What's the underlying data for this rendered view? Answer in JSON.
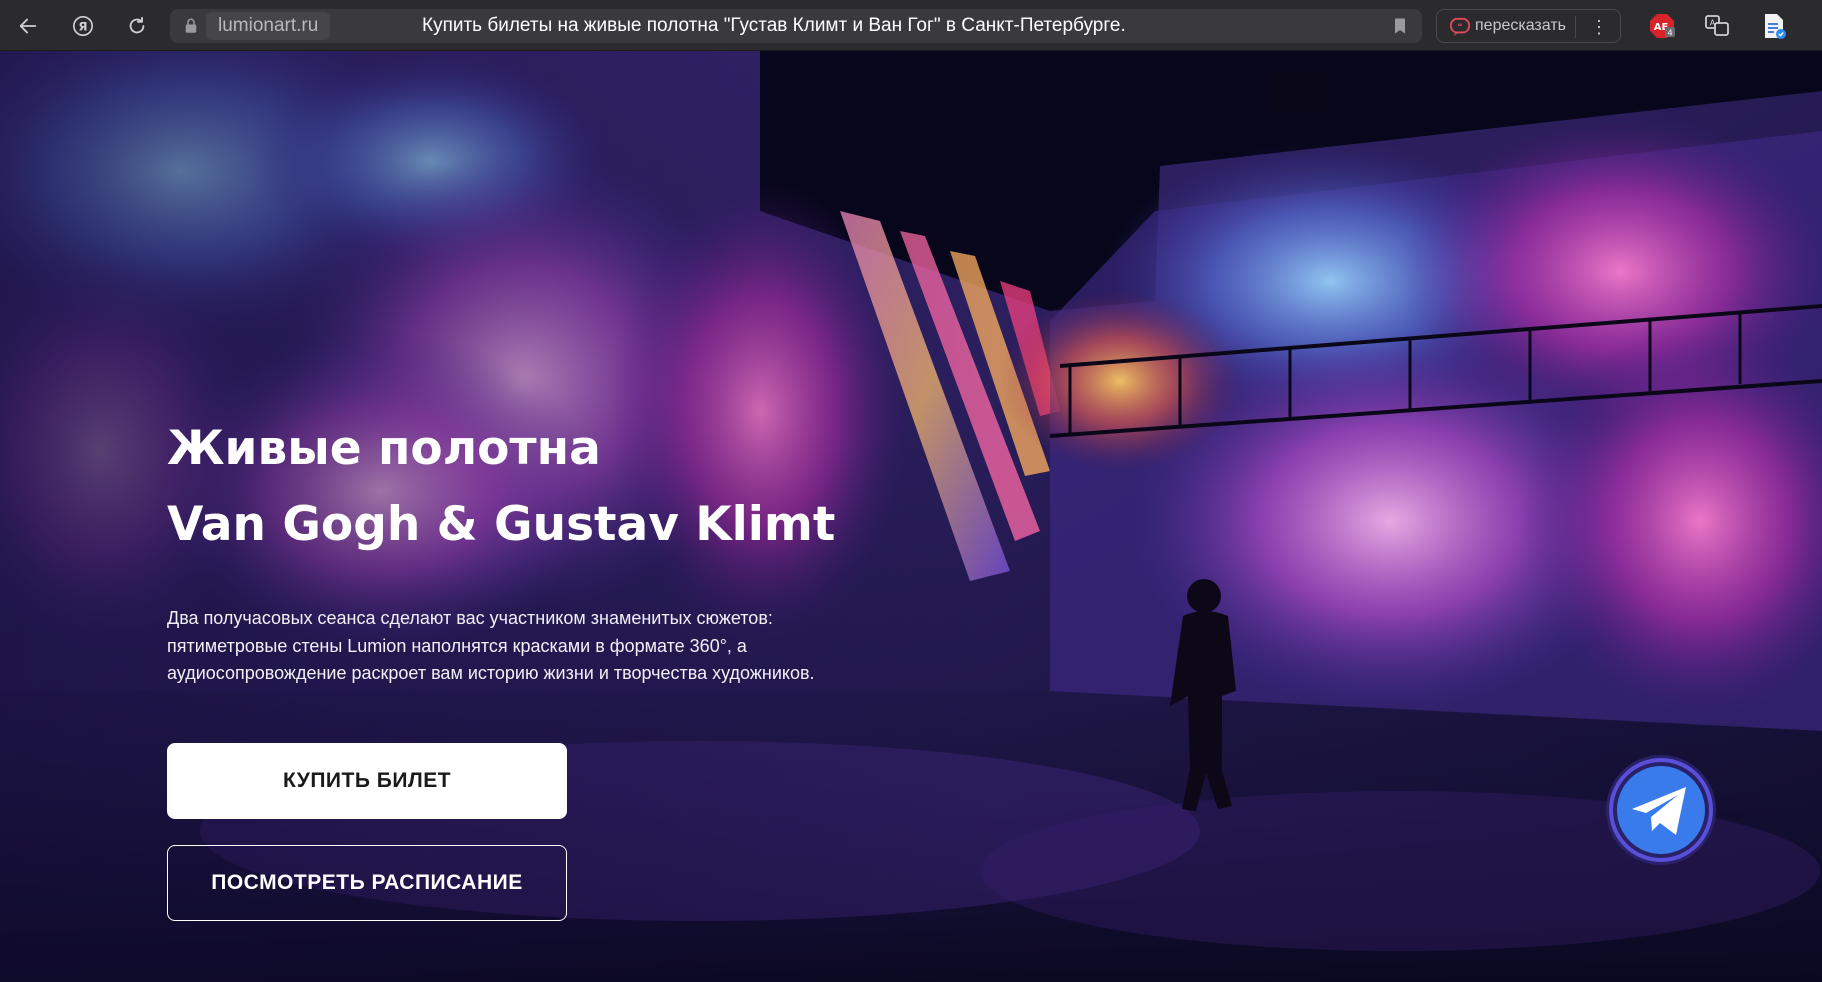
{
  "browser": {
    "domain": "lumionart.ru",
    "title": "Купить билеты на живые полотна \"Густав Климт и Ван Гог\" в Санкт-Петербурге.",
    "retell_label": "пересказать",
    "icons": [
      "back-arrow-icon",
      "yandex-logo-icon",
      "reload-icon",
      "lock-icon",
      "bookmark-icon",
      "retell-icon",
      "kebab-menu-icon",
      "adblock-extension-icon",
      "translate-extension-icon",
      "document-extension-icon"
    ],
    "extension_badge": "4"
  },
  "hero": {
    "title_line1": "Живые полотна",
    "title_line2": "Van Gogh & Gustav Klimt",
    "description": "Два получасовых сеанса сделают вас участником знаменитых сюжетов: пятиметровые стены Lumion наполнятся красками в формате 360°, а аудиосопровождение раскроет вам историю жизни и творчества художников.",
    "buy_button": "КУПИТЬ БИЛЕТ",
    "schedule_button": "ПОСМОТРЕТЬ РАСПИСАНИЕ"
  },
  "colors": {
    "browser_bar": "#2b2b2e",
    "telegram_blue": "#3a7bec",
    "telegram_ring": "#5a4fd8",
    "button_white": "#ffffff"
  }
}
